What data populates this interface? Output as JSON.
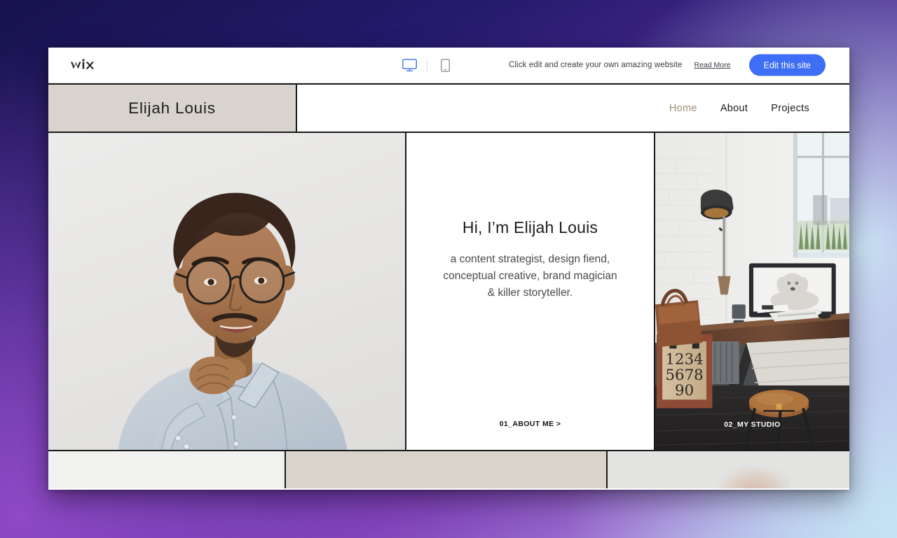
{
  "toolbar": {
    "logo_text": "WiX",
    "desktop_icon": "desktop-monitor-icon",
    "mobile_icon": "mobile-phone-icon",
    "promo_text": "Click edit and create your own amazing website",
    "read_more_label": "Read More",
    "edit_button_label": "Edit this site",
    "accent_color": "#3e6ef5"
  },
  "site_header": {
    "brand_name": "Elijah Louis",
    "brand_block_color": "#d8d3cd",
    "nav": [
      {
        "label": "Home",
        "active": true
      },
      {
        "label": "About",
        "active": false
      },
      {
        "label": "Projects",
        "active": false
      }
    ],
    "active_nav_color": "#9c8e78"
  },
  "hero": {
    "portrait": {
      "alt": "portrait-of-man-with-glasses",
      "background_color": "#e6e5e3"
    },
    "intro": {
      "title": "Hi, I’m Elijah Louis",
      "subtitle": "a content strategist, design fiend, conceptual creative, brand magician & killer storyteller.",
      "link_label": "01_ABOUT ME  >"
    },
    "studio": {
      "alt": "home-studio-desk-with-monitor",
      "label": "02_MY STUDIO"
    }
  },
  "bottom_strips": [
    {
      "name": "strip-light",
      "color": "#f1f1f0"
    },
    {
      "name": "strip-beige",
      "color": "#d9d3cb"
    },
    {
      "name": "strip-plant",
      "color": "#e3e3e2"
    }
  ]
}
